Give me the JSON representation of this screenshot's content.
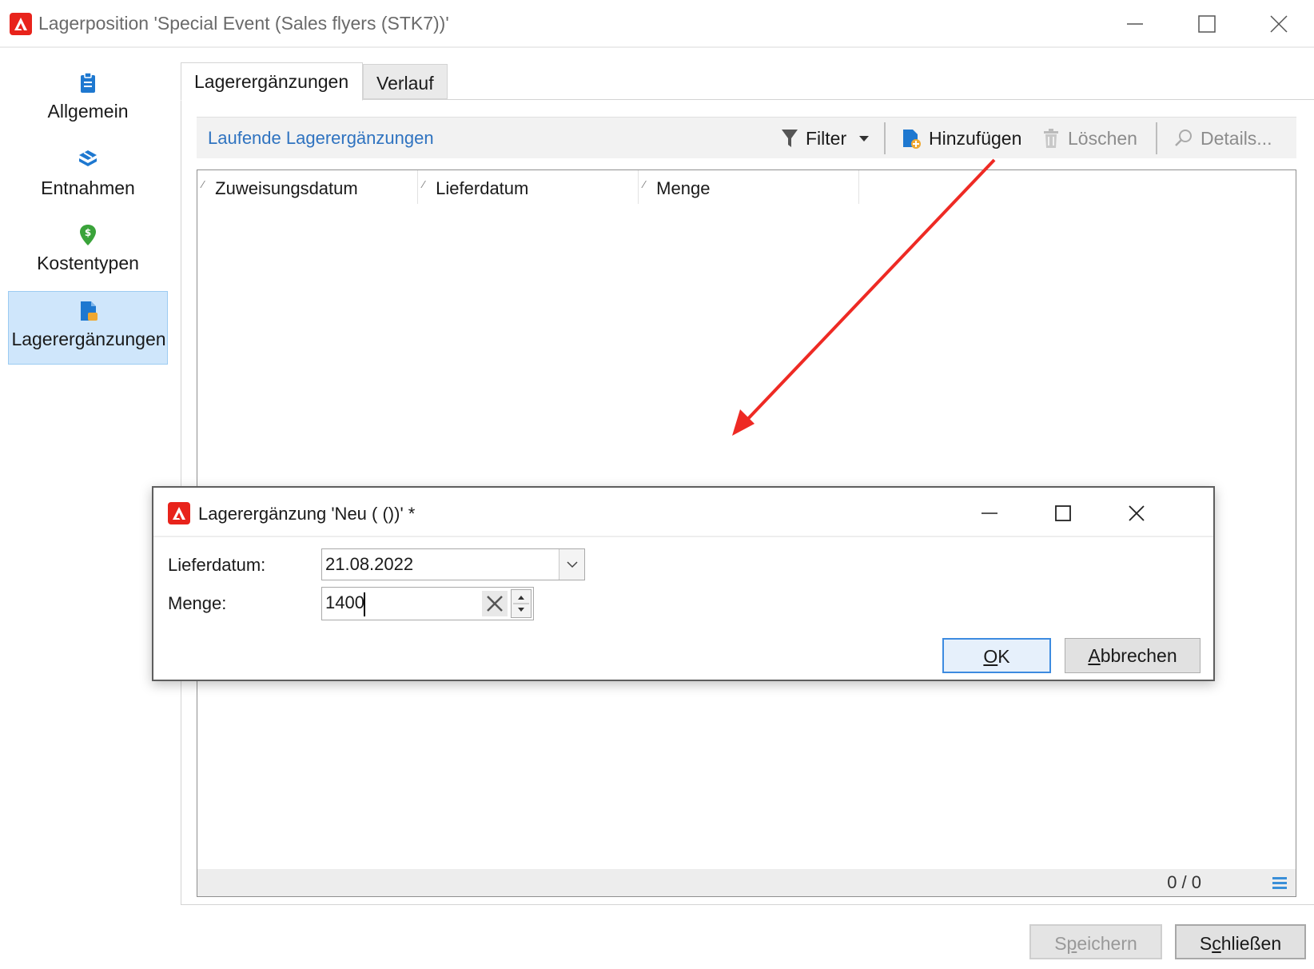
{
  "window": {
    "title": "Lagerposition 'Special Event (Sales flyers (STK7))'"
  },
  "nav": {
    "items": [
      {
        "label": "Allgemein",
        "icon": "clipboard-icon"
      },
      {
        "label": "Entnahmen",
        "icon": "boxes-icon"
      },
      {
        "label": "Kostentypen",
        "icon": "cost-pin-icon"
      },
      {
        "label": "Lagerergänzungen",
        "icon": "document-add-icon",
        "active": true
      }
    ]
  },
  "tabs": [
    {
      "label": "Lagerergänzungen",
      "active": true
    },
    {
      "label": "Verlauf",
      "active": false
    }
  ],
  "toolbar": {
    "title": "Laufende Lagerergänzungen",
    "filter_label": "Filter",
    "add_label": "Hinzufügen",
    "delete_label": "Löschen",
    "details_label": "Details..."
  },
  "grid": {
    "columns": [
      "Zuweisungsdatum",
      "Lieferdatum",
      "Menge"
    ],
    "rows": [],
    "count": "0 / 0"
  },
  "buttons": {
    "save_pre": "S",
    "save_u": "p",
    "save_post": "eichern",
    "close_pre": "S",
    "close_u": "c",
    "close_post": "hließen"
  },
  "dialog": {
    "title": "Lagerergänzung 'Neu ( ())' *",
    "delivery_label": "Lieferdatum:",
    "delivery_value": "21.08.2022",
    "quantity_label": "Menge:",
    "quantity_value": "1400",
    "ok_u": "O",
    "ok_post": "K",
    "cancel_u": "A",
    "cancel_post": "bbrechen"
  },
  "colors": {
    "accent": "#2f73c0",
    "brand": "#e8231b",
    "annotation_arrow": "#ee2a24",
    "nav_active_bg": "#cfe6fb"
  }
}
